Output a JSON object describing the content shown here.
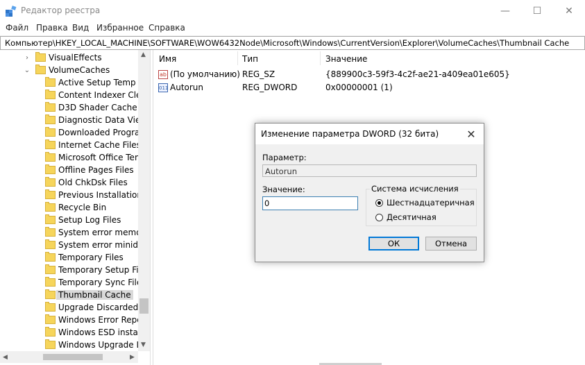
{
  "window": {
    "title": "Редактор реестра",
    "minimize_glyph": "—",
    "maximize_glyph": "☐",
    "close_glyph": "✕"
  },
  "menu": [
    "Файл",
    "Правка",
    "Вид",
    "Избранное",
    "Справка"
  ],
  "address": "Компьютер\\HKEY_LOCAL_MACHINE\\SOFTWARE\\WOW6432Node\\Microsoft\\Windows\\CurrentVersion\\Explorer\\VolumeCaches\\Thumbnail Cache",
  "tree": {
    "parents": [
      {
        "label": "VisualEffects",
        "expander": "›"
      },
      {
        "label": "VolumeCaches",
        "expander": "⌄"
      }
    ],
    "children": [
      "Active Setup Temp Fo",
      "Content Indexer Clear",
      "D3D Shader Cache",
      "Diagnostic Data Viewe",
      "Downloaded Program",
      "Internet Cache Files",
      "Microsoft Office Temp",
      "Offline Pages Files",
      "Old ChkDsk Files",
      "Previous Installations",
      "Recycle Bin",
      "Setup Log Files",
      "System error memory",
      "System error minidum",
      "Temporary Files",
      "Temporary Setup Files",
      "Temporary Sync Files",
      "Thumbnail Cache",
      "Upgrade Discarded Fil",
      "Windows Error Report",
      "Windows ESD installat",
      "Windows Upgrade Lo"
    ],
    "selected": "Thumbnail Cache"
  },
  "list": {
    "columns": [
      "Имя",
      "Тип",
      "Значение"
    ],
    "rows": [
      {
        "icon": "string-value-icon",
        "glyph": "ab",
        "name": "(По умолчанию)",
        "type": "REG_SZ",
        "value": "{889900c3-59f3-4c2f-ae21-a409ea01e605}"
      },
      {
        "icon": "dword-value-icon",
        "glyph": "011",
        "name": "Autorun",
        "type": "REG_DWORD",
        "value": "0x00000001 (1)"
      }
    ]
  },
  "dialog": {
    "title": "Изменение параметра DWORD (32 бита)",
    "close_glyph": "✕",
    "param_label": "Параметр:",
    "param_value": "Autorun",
    "value_label": "Значение:",
    "value_input": "0",
    "radix_label": "Система исчисления",
    "radix_options": [
      "Шестнадцатеричная",
      "Десятичная"
    ],
    "radix_selected": "Шестнадцатеричная",
    "ok_label": "ОК",
    "cancel_label": "Отмена"
  },
  "colors": {
    "selection": "#d9d9d9",
    "folder": "#f6d55b",
    "focus_border": "#0078d7"
  }
}
